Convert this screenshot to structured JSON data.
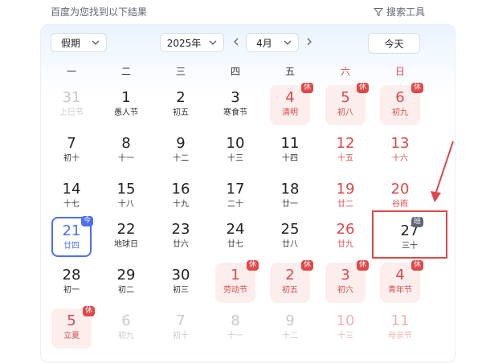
{
  "header": {
    "result_text": "百度为您找到以下结果",
    "tools_label": "搜索工具"
  },
  "controls": {
    "holiday_label": "假期",
    "year_label": "2025年",
    "month_label": "4月",
    "today_label": "今天"
  },
  "weekdays": [
    "一",
    "二",
    "三",
    "四",
    "五",
    "六",
    "日"
  ],
  "badges": {
    "rest": "休",
    "work": "班",
    "today": "今"
  },
  "rows": [
    [
      {
        "n": "31",
        "s": "上巳节"
      },
      {
        "n": "1",
        "s": "愚人节"
      },
      {
        "n": "2",
        "s": "初五"
      },
      {
        "n": "3",
        "s": "寒食节"
      },
      {
        "n": "4",
        "s": "清明"
      },
      {
        "n": "5",
        "s": "初八"
      },
      {
        "n": "6",
        "s": "初九"
      }
    ],
    [
      {
        "n": "7",
        "s": "初十"
      },
      {
        "n": "8",
        "s": "十一"
      },
      {
        "n": "9",
        "s": "十二"
      },
      {
        "n": "10",
        "s": "十三"
      },
      {
        "n": "11",
        "s": "十四"
      },
      {
        "n": "12",
        "s": "十五"
      },
      {
        "n": "13",
        "s": "十六"
      }
    ],
    [
      {
        "n": "14",
        "s": "十七"
      },
      {
        "n": "15",
        "s": "十八"
      },
      {
        "n": "16",
        "s": "十九"
      },
      {
        "n": "17",
        "s": "二十"
      },
      {
        "n": "18",
        "s": "廿一"
      },
      {
        "n": "19",
        "s": "廿二"
      },
      {
        "n": "20",
        "s": "谷雨"
      }
    ],
    [
      {
        "n": "21",
        "s": "廿四"
      },
      {
        "n": "22",
        "s": "地球日"
      },
      {
        "n": "23",
        "s": "廿六"
      },
      {
        "n": "24",
        "s": "廿七"
      },
      {
        "n": "25",
        "s": "廿八"
      },
      {
        "n": "26",
        "s": "廿九"
      },
      {
        "n": "27",
        "s": "三十"
      }
    ],
    [
      {
        "n": "28",
        "s": "初一"
      },
      {
        "n": "29",
        "s": "初二"
      },
      {
        "n": "30",
        "s": "初三"
      },
      {
        "n": "1",
        "s": "劳动节"
      },
      {
        "n": "2",
        "s": "初五"
      },
      {
        "n": "3",
        "s": "初六"
      },
      {
        "n": "4",
        "s": "青年节"
      }
    ],
    [
      {
        "n": "5",
        "s": "立夏"
      },
      {
        "n": "6",
        "s": "初九"
      },
      {
        "n": "7",
        "s": "初十"
      },
      {
        "n": "8",
        "s": "十一"
      },
      {
        "n": "9",
        "s": "十二"
      },
      {
        "n": "10",
        "s": "十三"
      },
      {
        "n": "11",
        "s": "母亲节"
      }
    ]
  ],
  "colors": {
    "accent_red": "#e04848",
    "today_blue": "#4e6ef2",
    "holiday_bg": "#fdeeee"
  }
}
